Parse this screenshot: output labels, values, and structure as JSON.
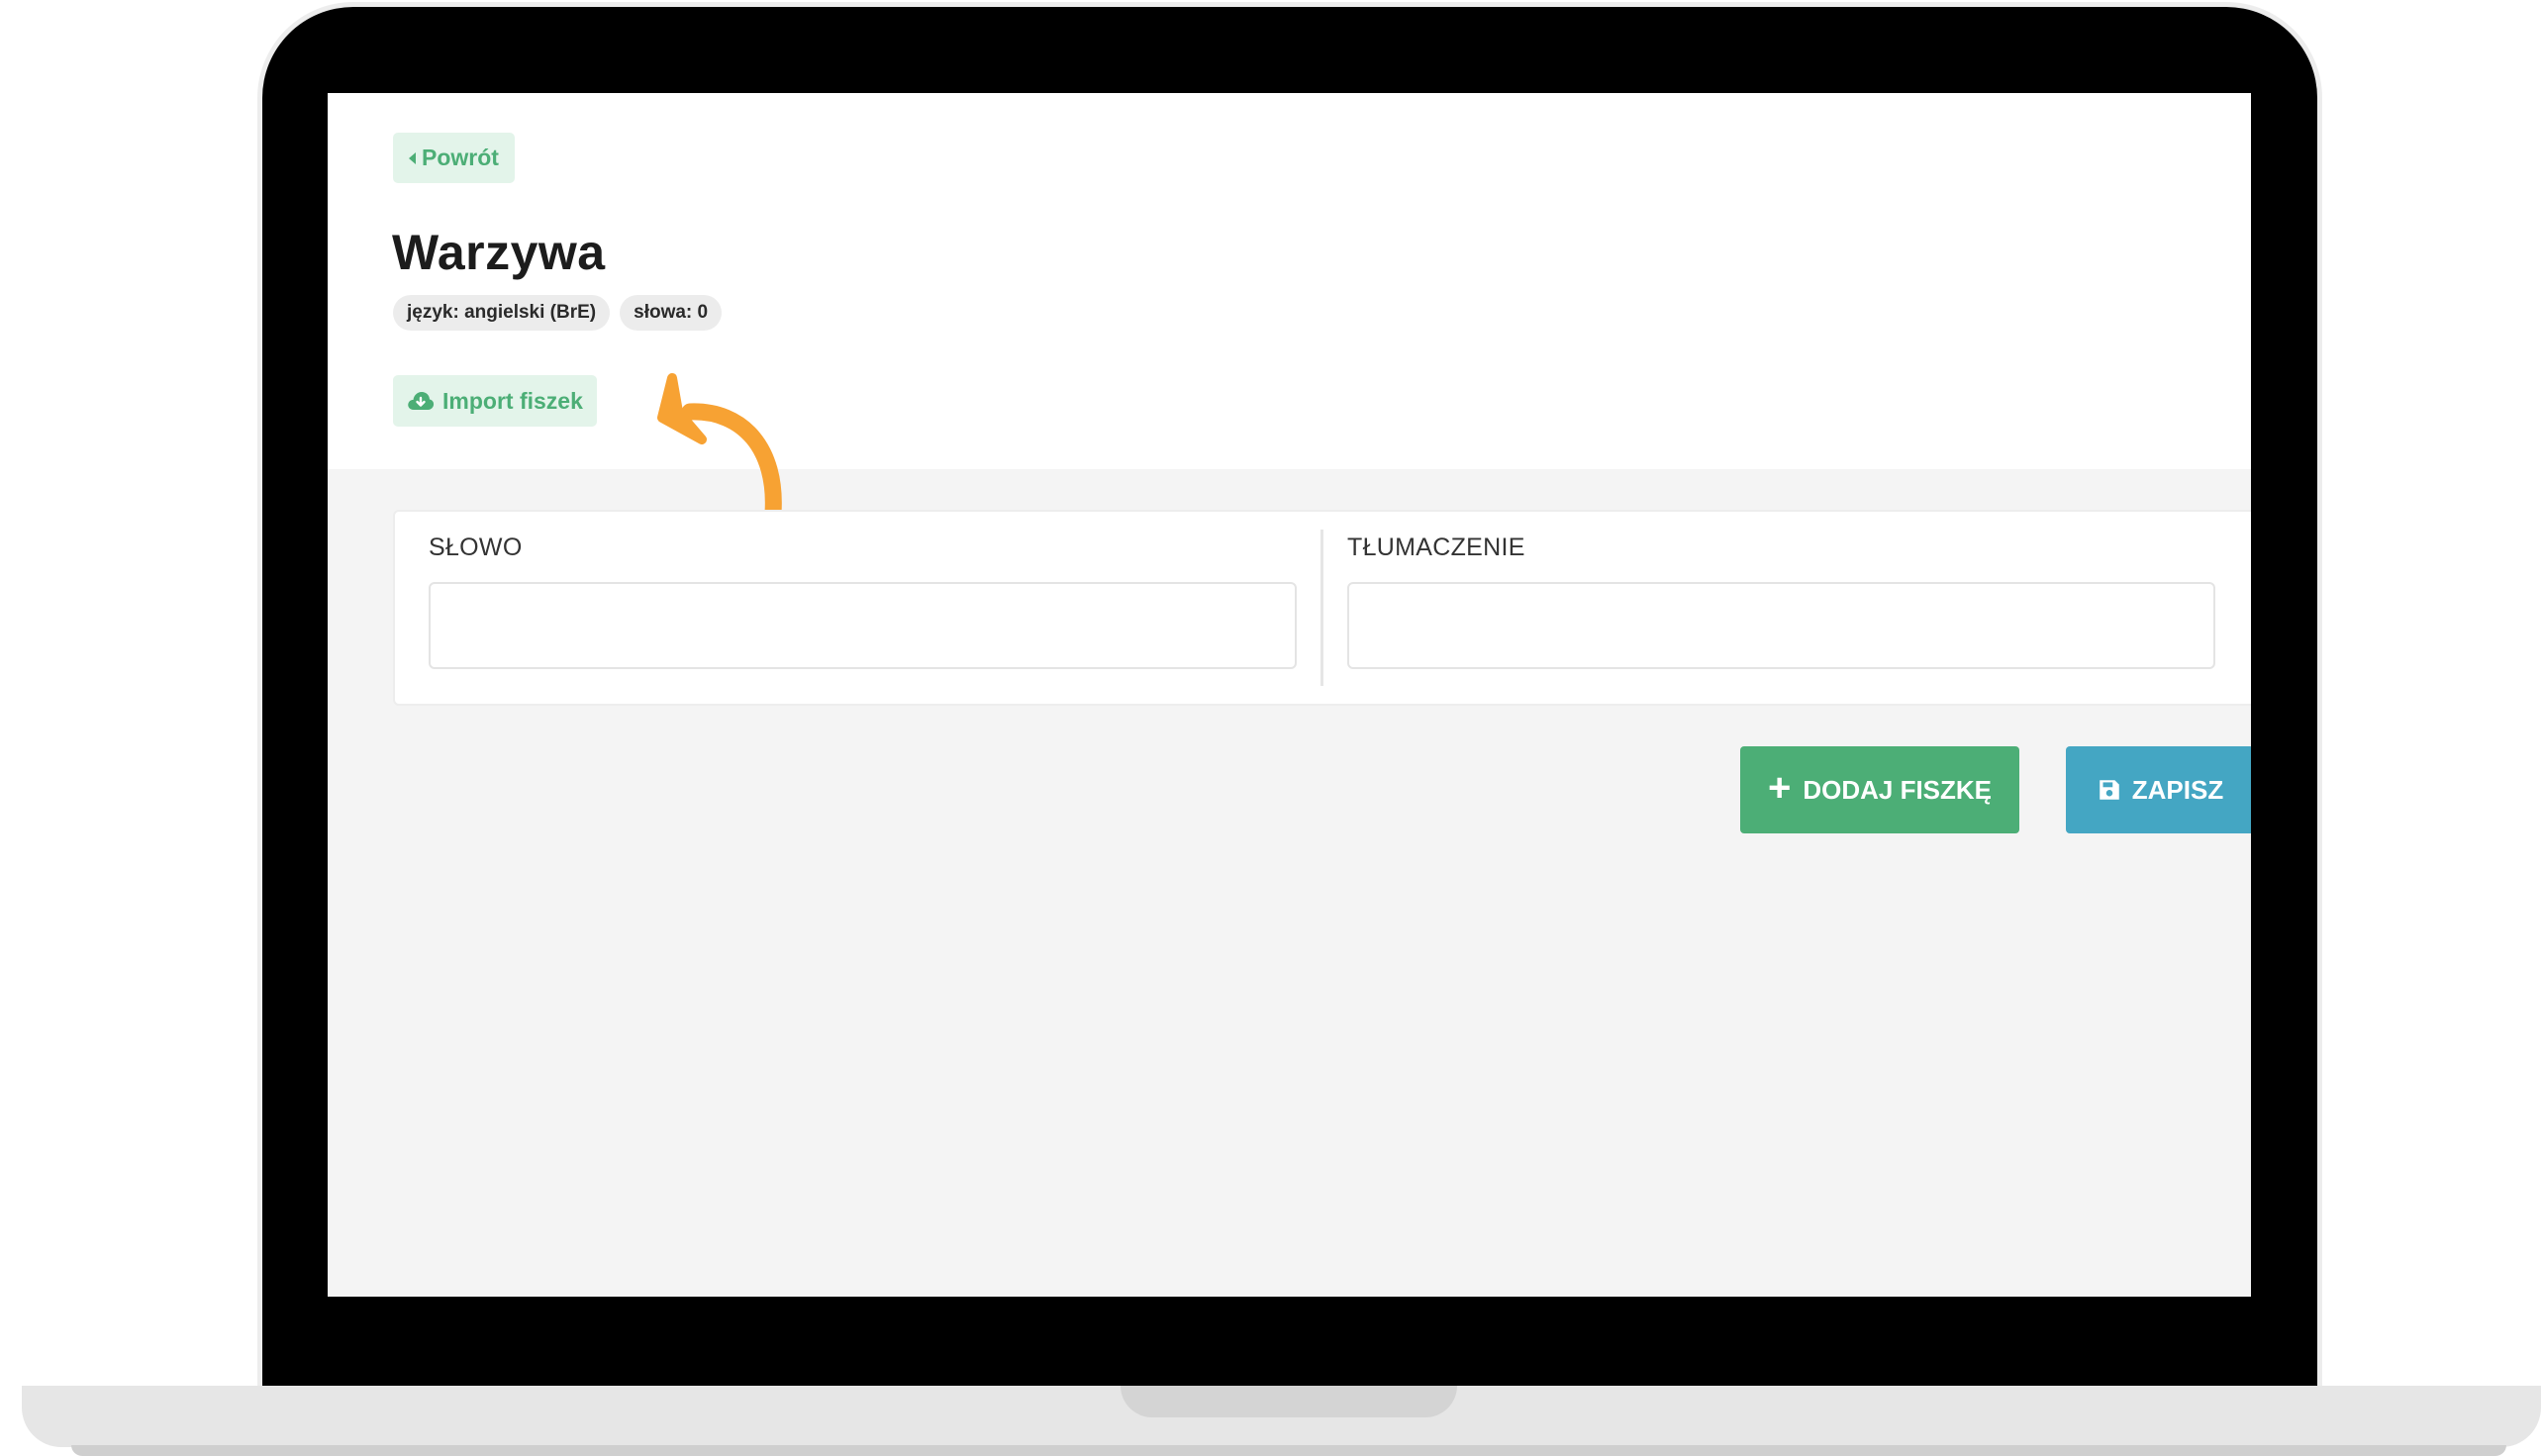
{
  "nav": {
    "back_label": "Powrót"
  },
  "deck": {
    "title": "Warzywa",
    "badges": [
      "język: angielski (BrE)",
      "słowa: 0"
    ]
  },
  "import": {
    "label": "Import fiszek"
  },
  "form": {
    "word_label": "SŁOWO",
    "word_value": "",
    "translation_label": "TŁUMACZENIE",
    "translation_value": ""
  },
  "actions": {
    "add_label": "DODAJ FISZKĘ",
    "save_label": "ZAPISZ"
  },
  "colors": {
    "green": "#4cae76",
    "green_light": "#e3f4ea",
    "blue": "#44a6c3",
    "arrow": "#f7a233"
  },
  "icons": {
    "back": "chevron-left-icon",
    "import": "cloud-download-icon",
    "add": "plus-icon",
    "save": "floppy-disk-icon",
    "annotation": "curved-arrow-icon"
  }
}
